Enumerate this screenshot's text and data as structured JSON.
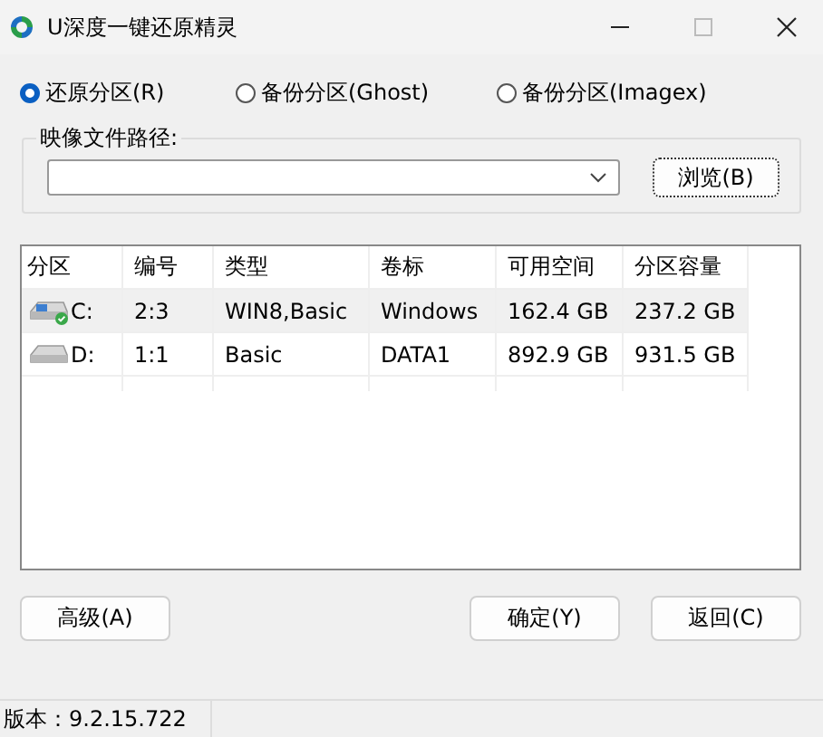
{
  "window": {
    "title": "U深度一键还原精灵"
  },
  "modes": [
    {
      "label": "还原分区(R)",
      "selected": true
    },
    {
      "label": "备份分区(Ghost)",
      "selected": false
    },
    {
      "label": "备份分区(Imagex)",
      "selected": false
    }
  ],
  "image_path": {
    "label": "映像文件路径:",
    "browse": "浏览(B)"
  },
  "table": {
    "columns": [
      "分区",
      "编号",
      "类型",
      "卷标",
      "可用空间",
      "分区容量"
    ],
    "rows": [
      {
        "selected": true,
        "system": true,
        "cells": [
          "C:",
          "2:3",
          "WIN8,Basic",
          "Windows",
          "162.4 GB",
          "237.2 GB"
        ]
      },
      {
        "selected": false,
        "system": false,
        "cells": [
          "D:",
          "1:1",
          "Basic",
          "DATA1",
          "892.9 GB",
          "931.5 GB"
        ]
      }
    ]
  },
  "buttons": {
    "advanced": "高级(A)",
    "ok": "确定(Y)",
    "back": "返回(C)"
  },
  "status_bar": {
    "version": "版本：9.2.15.722"
  }
}
